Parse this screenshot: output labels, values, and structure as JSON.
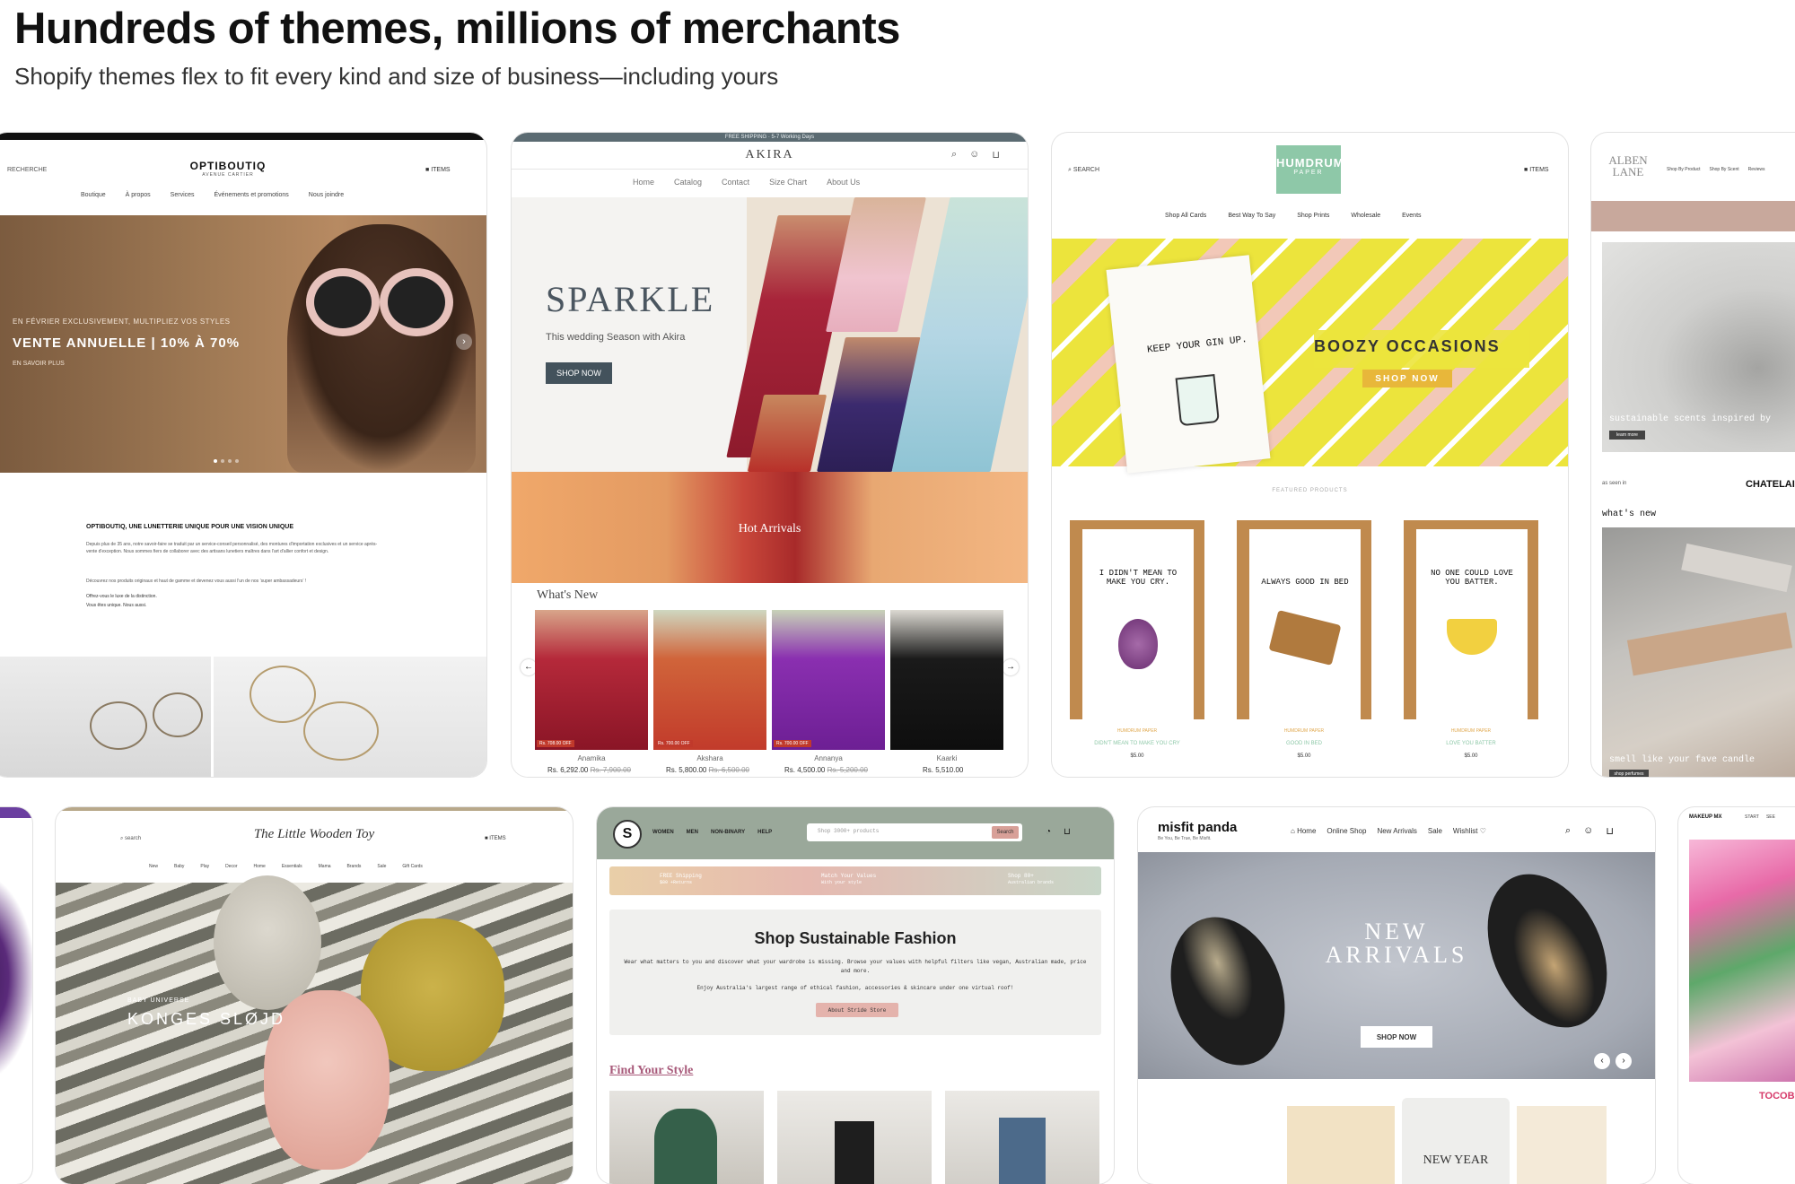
{
  "header": {
    "title": "Hundreds of themes, millions of merchants",
    "subtitle": "Shopify themes flex to fit every kind and size of business—including yours"
  },
  "optiboutiq": {
    "search": "RECHERCHE",
    "logo": "OPTIBOUTIQ",
    "logo_sub": "AVENUE CARTIER",
    "items": "ITEMS",
    "nav": [
      "Boutique",
      "À propos",
      "Services",
      "Événements et promotions",
      "Nous joindre"
    ],
    "hero_kicker": "EN FÉVRIER EXCLUSIVEMENT, MULTIPLIEZ VOS STYLES",
    "hero_title": "VENTE ANNUELLE | 10% À 70%",
    "hero_link": "EN SAVOIR PLUS",
    "section_title": "OPTIBOUTIQ, UNE LUNETTERIE UNIQUE POUR UNE VISION UNIQUE",
    "para1": "Depuis plus de 35 ans, notre savoir-faire se traduit par un service-conseil personnalisé, des montures d'importation exclusives et un service après-vente d'exception. Nous sommes fiers de collaborer avec des artisans lunetiers maîtres dans l'art d'allier confort et design.",
    "para2": "Découvrez nos produits originaux et haut de gamme et devenez vous aussi l'un de nos ‘super ambassadeurs’ !",
    "para3": "Offrez-vous le luxe de la distinction.",
    "para4": "Vous êtes unique. Nous aussi."
  },
  "akira": {
    "announcement": "FREE SHIPPING · 5-7 Working Days",
    "logo": "AKIRA",
    "nav": [
      "Home",
      "Catalog",
      "Contact",
      "Size Chart",
      "About Us"
    ],
    "hero_title": "SPARKLE",
    "hero_sub": "This wedding Season with Akira",
    "shop_button": "SHOP NOW",
    "hot": "Hot Arrivals",
    "whats_new": "What's New",
    "products": [
      {
        "name": "Anamika",
        "price": "Rs. 6,292.00",
        "old": "Rs. 7,900.00",
        "badge": "Rs. 708.00 OFF"
      },
      {
        "name": "Akshara",
        "price": "Rs. 5,800.00",
        "old": "Rs. 6,500.00",
        "badge": "Rs. 700.00 OFF"
      },
      {
        "name": "Annanya",
        "price": "Rs. 4,500.00",
        "old": "Rs. 5,200.00",
        "badge": "Rs. 700.00 OFF"
      },
      {
        "name": "Kaarki",
        "price": "Rs. 5,510.00",
        "old": "",
        "badge": ""
      }
    ]
  },
  "humdrum": {
    "search": "SEARCH",
    "logo_top": "HUMDRUM",
    "logo_bottom": "PAPER",
    "items": "ITEMS",
    "nav": [
      "Shop All Cards",
      "Best Way To Say",
      "Shop Prints",
      "Wholesale",
      "Events"
    ],
    "card_text": "KEEP YOUR GIN UP.",
    "hero_title": "BOOZY OCCASIONS",
    "hero_button": "SHOP NOW",
    "featured": "FEATURED PRODUCTS",
    "products": [
      {
        "card": "I DIDN'T MEAN TO MAKE YOU CRY.",
        "brand": "HUMDRUM PAPER",
        "name": "DIDN'T MEAN TO MAKE YOU CRY",
        "price": "$5.00"
      },
      {
        "card": "ALWAYS GOOD IN BED",
        "brand": "HUMDRUM PAPER",
        "name": "GOOD IN BED",
        "price": "$5.00"
      },
      {
        "card": "NO ONE COULD LOVE YOU BATTER.",
        "brand": "HUMDRUM PAPER",
        "name": "LOVE YOU BATTER",
        "price": "$5.00"
      }
    ]
  },
  "albenlane": {
    "logo": "ALBEN LANE",
    "nav": [
      "Shop By Product",
      "Shop By Scent",
      "Reviews"
    ],
    "hero_text": "sustainable scents inspired by",
    "hero_button": "learn more",
    "as_seen": "as seen in",
    "chatelaine": "CHATELAINE",
    "whats_new": "what's new",
    "bottom_text": "smell like your fave candle",
    "bottom_button": "shop perfumes"
  },
  "konges": {
    "search": "search",
    "logo": "The Little Wooden Toy",
    "items": "ITEMS",
    "nav": [
      "New",
      "Baby",
      "Play",
      "Decor",
      "Home",
      "Essentials",
      "Mama",
      "Brands",
      "Sale",
      "Gift Cards"
    ],
    "kicker": "BABY UNIVERSE",
    "hero_title": "KONGES SLØJD"
  },
  "stride": {
    "nav": [
      "WOMEN",
      "MEN",
      "NON-BINARY",
      "HELP"
    ],
    "search_placeholder": "Shop 3000+ products",
    "search_button": "Search",
    "features": [
      "FREE Shipping",
      "Match Your Values",
      "Shop 80+"
    ],
    "features_sub": [
      "$80 +Returns",
      "With your style",
      "Australian brands"
    ],
    "title": "Shop Sustainable Fashion",
    "para1": "Wear what matters to you and discover what your wardrobe is missing. Browse your values with helpful filters like vegan, Australian made, price and more.",
    "para2": "Enjoy Australia's largest range of ethical fashion, accessories & skincare under one virtual roof!",
    "about_button": "About Stride Store",
    "find_style": "Find Your Style"
  },
  "misfit": {
    "logo": "misfit panda",
    "tagline": "Be You, Be True, Be Misfit.",
    "nav": [
      "Home",
      "Online Shop",
      "New Arrivals",
      "Sale",
      "Wishlist"
    ],
    "hero_title_1": "NEW",
    "hero_title_2": "ARRIVALS",
    "shop_button": "SHOP NOW",
    "bottom_card": "NEW YEAR"
  },
  "makeup": {
    "logo": "MAKEUP MX",
    "nav": [
      "START",
      "SEE"
    ],
    "label": "TOCOB"
  },
  "colors": {
    "akira_button": "#43525c",
    "humdrum_yellow": "#ece43c",
    "humdrum_green": "#8ec8a8",
    "misfit_bg": "#a5aab4",
    "stride_bar": "#e9cfa8"
  }
}
